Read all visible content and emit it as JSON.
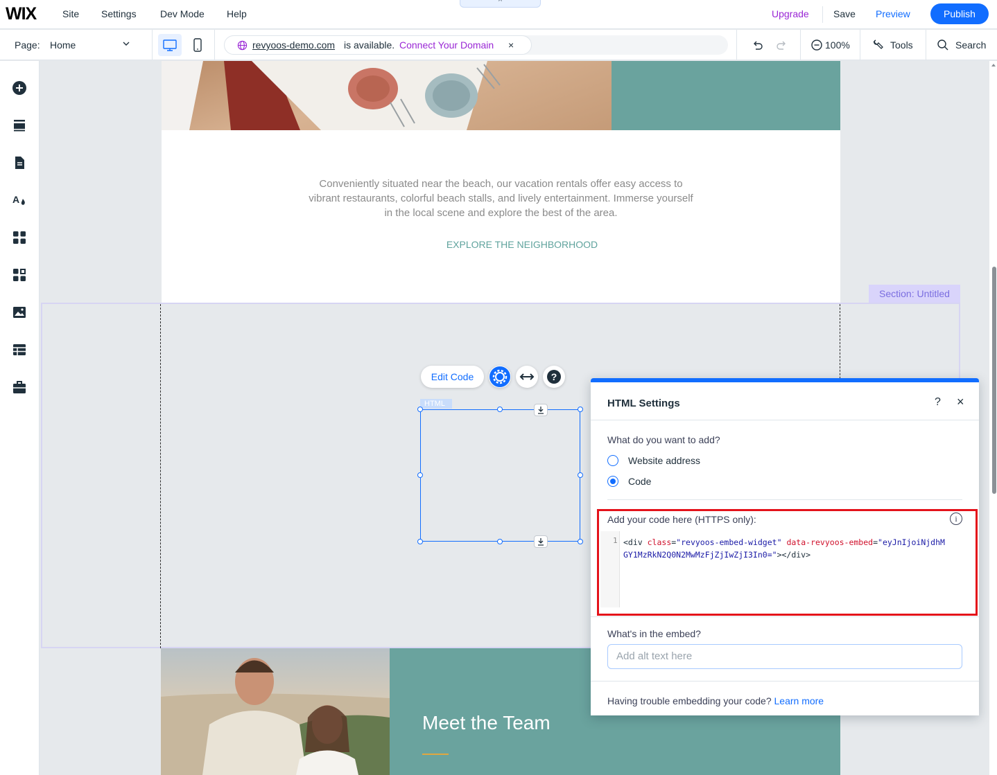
{
  "topbar": {
    "logo": "WIX",
    "menu": [
      "Site",
      "Settings",
      "Dev Mode",
      "Help"
    ],
    "tab_handle": "^",
    "upgrade": "Upgrade",
    "save": "Save",
    "preview": "Preview",
    "publish": "Publish"
  },
  "subbar": {
    "page_label": "Page:",
    "page_value": "Home",
    "domain": "revyoos-demo.com",
    "available": "is available.",
    "connect": "Connect Your Domain",
    "close": "×",
    "zoom": "100%",
    "tools": "Tools",
    "search": "Search"
  },
  "canvas": {
    "body_text": "Conveniently situated near the beach, our vacation rentals offer easy access to vibrant restaurants, colorful beach stalls, and lively entertainment. Immerse yourself in the local scene and explore the best of the area.",
    "explore": "EXPLORE THE NEIGHBORHOOD",
    "section_tag": "Section: Untitled",
    "edit_code": "Edit Code",
    "html_tag": "HTML",
    "team_title": "Meet the Team"
  },
  "panel": {
    "title": "HTML Settings",
    "help": "?",
    "close": "×",
    "question": "What do you want to add?",
    "options": [
      "Website address",
      "Code"
    ],
    "selected": "Code",
    "code_label": "Add your code here (HTTPS only):",
    "line_number": "1",
    "code_tag_open": "<div ",
    "code_attr1": "class",
    "code_eq1": "=",
    "code_val1": "\"revyoos-embed-widget\"",
    "code_attr2": "data-revyoos-embed",
    "code_eq2": "=",
    "code_val2": "\"eyJnIjoiNjdhMGY1MzRkN2Q0N2MwMzFjZjIwZjI3In0=\"",
    "code_tag_close": "></div>",
    "embed_label": "What's in the embed?",
    "alt_placeholder": "Add alt text here",
    "footer_text": "Having trouble embedding your code?",
    "footer_link": "Learn more"
  },
  "colors": {
    "accent": "#116dff",
    "upgrade": "#9a27d5",
    "teal": "#6aa39e",
    "highlight": "#e4121a"
  }
}
